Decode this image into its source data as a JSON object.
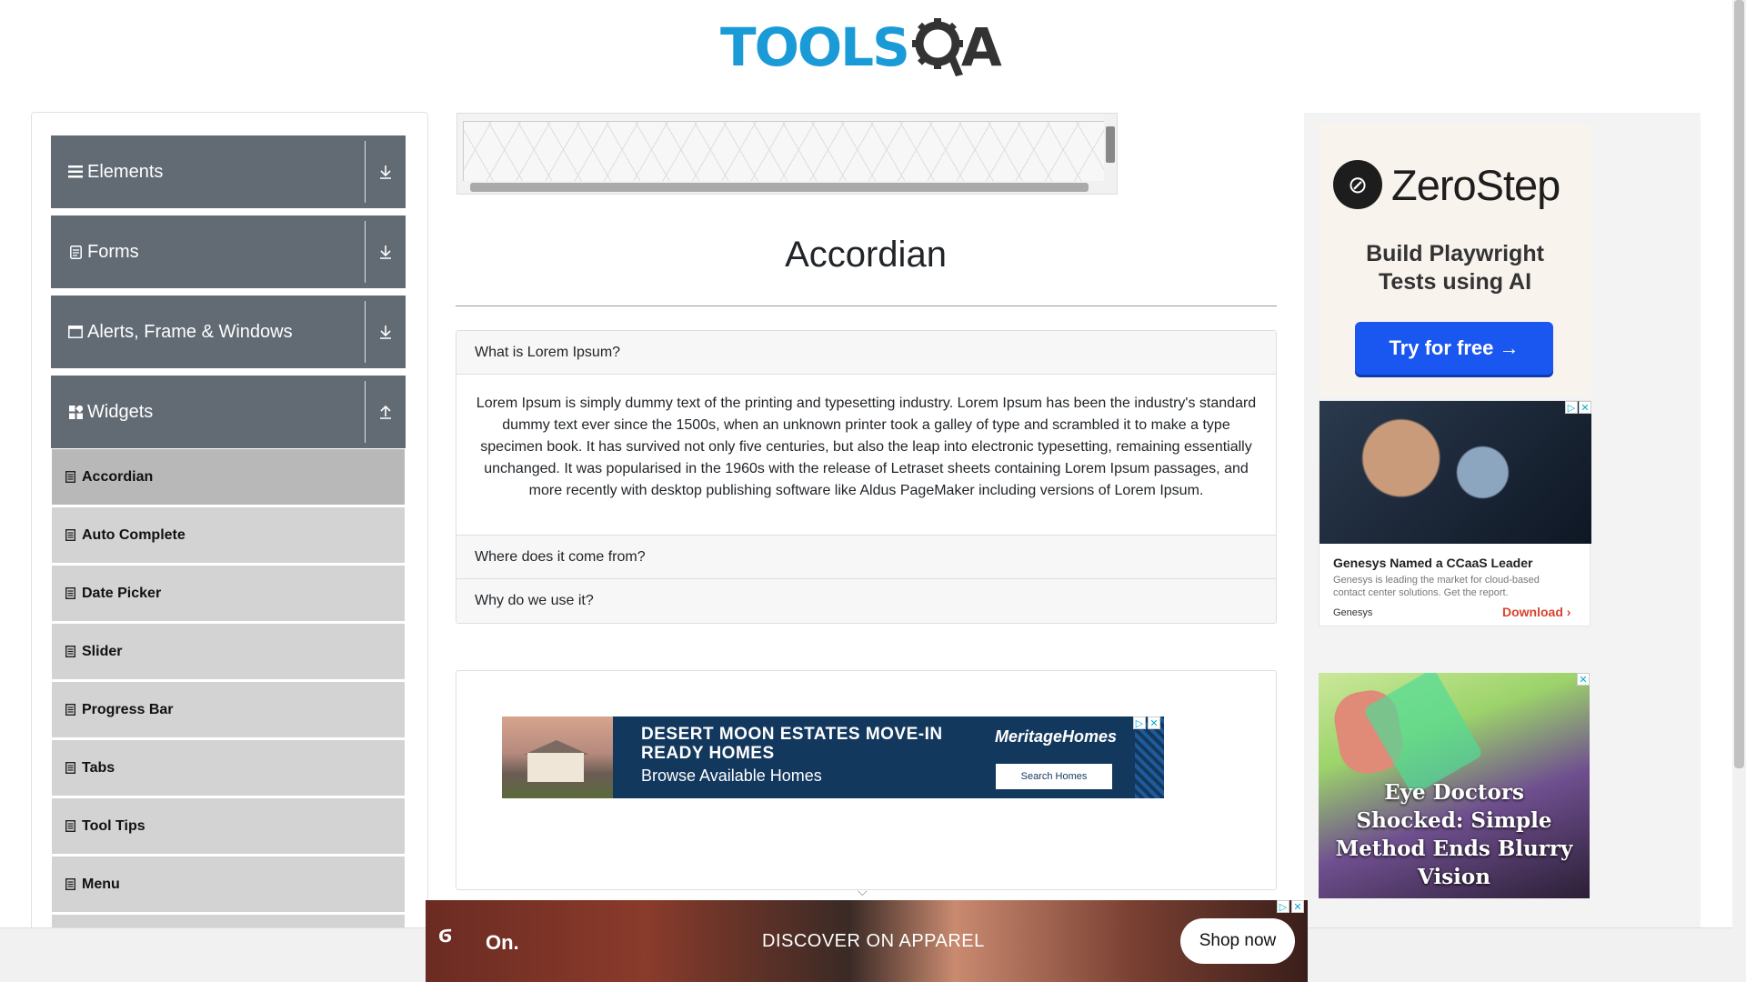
{
  "header": {
    "logo_text": "TOOLS",
    "logo_suffix": "A"
  },
  "sidebar": {
    "groups": [
      {
        "label": "Elements",
        "icon": "bars-icon",
        "arrow": "download-arrow-icon"
      },
      {
        "label": "Forms",
        "icon": "form-icon",
        "arrow": "download-arrow-icon"
      },
      {
        "label": "Alerts, Frame & Windows",
        "icon": "window-icon",
        "arrow": "download-arrow-icon"
      },
      {
        "label": "Widgets",
        "icon": "widgets-icon",
        "arrow": "upload-arrow-icon"
      }
    ],
    "items": [
      {
        "label": "Accordian",
        "active": true
      },
      {
        "label": "Auto Complete"
      },
      {
        "label": "Date Picker"
      },
      {
        "label": "Slider"
      },
      {
        "label": "Progress Bar"
      },
      {
        "label": "Tabs"
      },
      {
        "label": "Tool Tips"
      },
      {
        "label": "Menu"
      }
    ]
  },
  "main": {
    "title": "Accordian",
    "sections": [
      {
        "heading": "What is Lorem Ipsum?",
        "expanded": true,
        "body": "Lorem Ipsum is simply dummy text of the printing and typesetting industry. Lorem Ipsum has been the industry's standard dummy text ever since the 1500s, when an unknown printer took a galley of type and scrambled it to make a type specimen book. It has survived not only five centuries, but also the leap into electronic typesetting, remaining essentially unchanged. It was popularised in the 1960s with the release of Letraset sheets containing Lorem Ipsum passages, and more recently with desktop publishing software like Aldus PageMaker including versions of Lorem Ipsum."
      },
      {
        "heading": "Where does it come from?",
        "expanded": false
      },
      {
        "heading": "Why do we use it?",
        "expanded": false
      }
    ]
  },
  "ads": {
    "desert": {
      "headline": "DESERT MOON ESTATES MOVE-IN READY HOMES",
      "sub": "Browse Available Homes",
      "brand": "MeritageHomes",
      "button": "Search Homes"
    },
    "zerostep": {
      "name": "ZeroStep",
      "tagline": "Build Playwright Tests using AI",
      "button": "Try for free →"
    },
    "genesys": {
      "title": "Genesys Named a CCaaS Leader",
      "desc": "Genesys is leading the market for cloud-based contact center solutions. Get the report.",
      "brand": "Genesys",
      "cta": "Download"
    },
    "eye": {
      "headline": "Eye Doctors Shocked: Simple Method Ends Blurry Vision"
    },
    "on": {
      "logo": "On.",
      "text": "DISCOVER ON APPAREL",
      "button": "Shop now"
    }
  },
  "colors": {
    "sidebar_group": "#626a73",
    "sidebar_item": "#d3d3d3",
    "logo_blue": "#1a9bd7"
  }
}
